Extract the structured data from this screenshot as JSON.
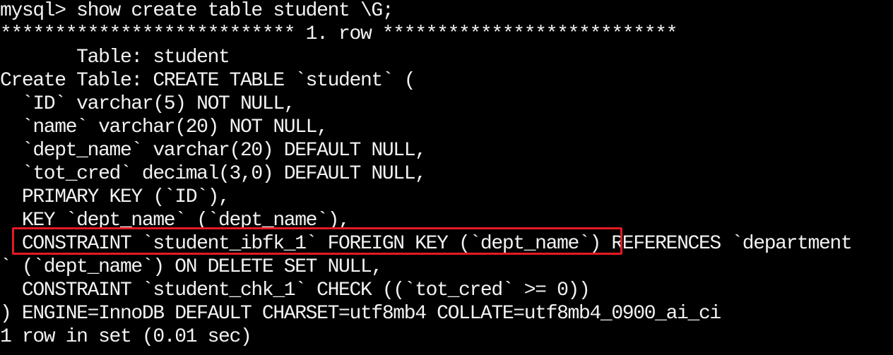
{
  "terminal": {
    "background": "#000000",
    "foreground": "#f2f2f2",
    "highlight_color": "#e31b23",
    "lines": [
      "mysql> show create table student \\G;",
      "*************************** 1. row ***************************",
      "       Table: student",
      "Create Table: CREATE TABLE `student` (",
      "  `ID` varchar(5) NOT NULL,",
      "  `name` varchar(20) NOT NULL,",
      "  `dept_name` varchar(20) DEFAULT NULL,",
      "  `tot_cred` decimal(3,0) DEFAULT NULL,",
      "  PRIMARY KEY (`ID`),",
      "  KEY `dept_name` (`dept_name`),",
      null,
      "` (`dept_name`) ON DELETE SET NULL,",
      "  CONSTRAINT `student_chk_1` CHECK ((`tot_cred` >= 0))",
      ") ENGINE=InnoDB DEFAULT CHARSET=utf8mb4 COLLATE=utf8mb4_0900_ai_ci",
      "1 row in set (0.01 sec)"
    ],
    "constraint_line": {
      "prefix": "  ",
      "highlighted": "CONSTRAINT `student_ibfk_1` FOREIGN KEY (`dept_name`)",
      "suffix": " REFERENCES `department"
    }
  }
}
